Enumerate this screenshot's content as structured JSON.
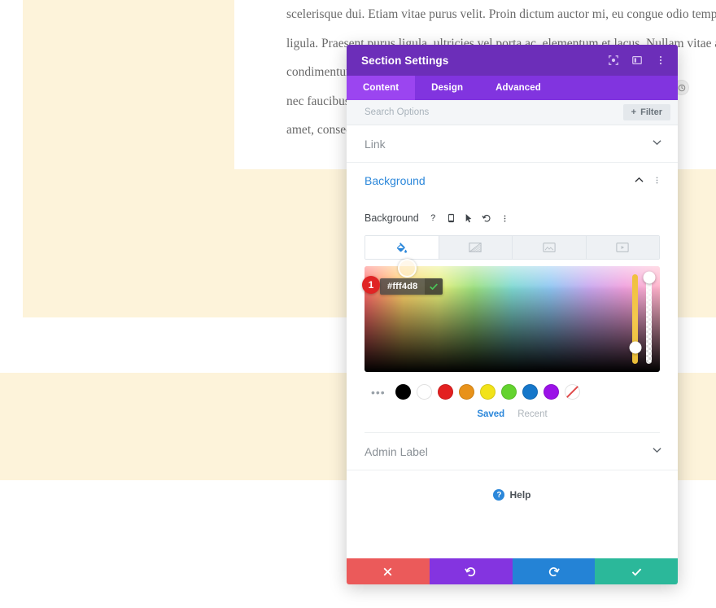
{
  "website": {
    "paragraph_lines": [
      "scelerisque dui. Etiam vitae purus velit. Proin dictum auctor mi, eu congue odio tempus et. Curabitu",
      "ligula. Praesent purus ligula, ultricies vel porta ac, elementum et lacus. Nullam vitae augue aliquet,",
      "condimentum                                                                                uris pulv",
      "nec faucibus                                                                                .m ipsu",
      "amet, consec"
    ],
    "section_color": "#fdf3da",
    "round_icon": "settings-circle-icon"
  },
  "modal": {
    "title": "Section Settings",
    "title_icons": [
      {
        "name": "fullscreen-icon",
        "glyph": "⬚"
      },
      {
        "name": "layout-panel-icon",
        "glyph": "▥"
      },
      {
        "name": "kebab-menu-icon",
        "glyph": "⋮"
      }
    ],
    "tabs": [
      {
        "label": "Content",
        "active": true
      },
      {
        "label": "Design",
        "active": false
      },
      {
        "label": "Advanced",
        "active": false
      }
    ],
    "search": {
      "placeholder": "Search Options",
      "value": "",
      "filter_label": "Filter",
      "filter_icon": "plus-icon"
    },
    "accordions": [
      {
        "name": "link",
        "label": "Link",
        "open": false,
        "chevron": "⌄"
      },
      {
        "name": "admin-label",
        "label": "Admin Label",
        "open": false,
        "chevron": "⌄"
      }
    ],
    "background_section": {
      "heading": "Background",
      "open": true,
      "chevron_up": "⌃",
      "kebab": "⋮",
      "field_label": "Background",
      "field_icons": [
        {
          "name": "help-question-icon",
          "glyph": "?"
        },
        {
          "name": "responsive-mobile-icon",
          "glyph": "▯"
        },
        {
          "name": "hover-cursor-icon",
          "glyph": "➤"
        },
        {
          "name": "reset-undo-icon",
          "glyph": "↺"
        },
        {
          "name": "options-kebab-icon",
          "glyph": "⋮"
        }
      ],
      "type_tabs": [
        {
          "name": "background-color-tab",
          "icon": "paint-bucket-icon",
          "active": true
        },
        {
          "name": "background-gradient-tab",
          "icon": "gradient-icon",
          "active": false
        },
        {
          "name": "background-image-tab",
          "icon": "image-icon",
          "active": false
        },
        {
          "name": "background-video-tab",
          "icon": "video-icon",
          "active": false
        }
      ],
      "picker": {
        "hex_value": "#fff4d8",
        "confirm_icon": "check-icon",
        "step_badge": "1",
        "hue_knob_percent": 82,
        "alpha_knob_percent": 4
      },
      "swatches": [
        {
          "name": "swatch-black",
          "color": "#000000"
        },
        {
          "name": "swatch-white",
          "color": "#ffffff"
        },
        {
          "name": "swatch-red",
          "color": "#e32020"
        },
        {
          "name": "swatch-orange",
          "color": "#e8921a"
        },
        {
          "name": "swatch-yellow",
          "color": "#f2e319"
        },
        {
          "name": "swatch-green",
          "color": "#63d32e"
        },
        {
          "name": "swatch-blue",
          "color": "#1577ca"
        },
        {
          "name": "swatch-purple",
          "color": "#9b11e8"
        },
        {
          "name": "swatch-none",
          "color": "transparent"
        }
      ],
      "more_swatches_icon": "•••",
      "palette_tabs": [
        {
          "label": "Saved",
          "active": true
        },
        {
          "label": "Recent",
          "active": false
        }
      ]
    },
    "help": {
      "label": "Help",
      "icon_glyph": "?"
    },
    "footer_buttons": [
      {
        "name": "cancel-button",
        "glyph": "✕",
        "color": "#eb5a5a"
      },
      {
        "name": "undo-button",
        "glyph": "↺",
        "color": "#8434e0"
      },
      {
        "name": "redo-button",
        "glyph": "↻",
        "color": "#2483d6"
      },
      {
        "name": "save-button",
        "glyph": "✓",
        "color": "#2bb89a"
      }
    ]
  }
}
